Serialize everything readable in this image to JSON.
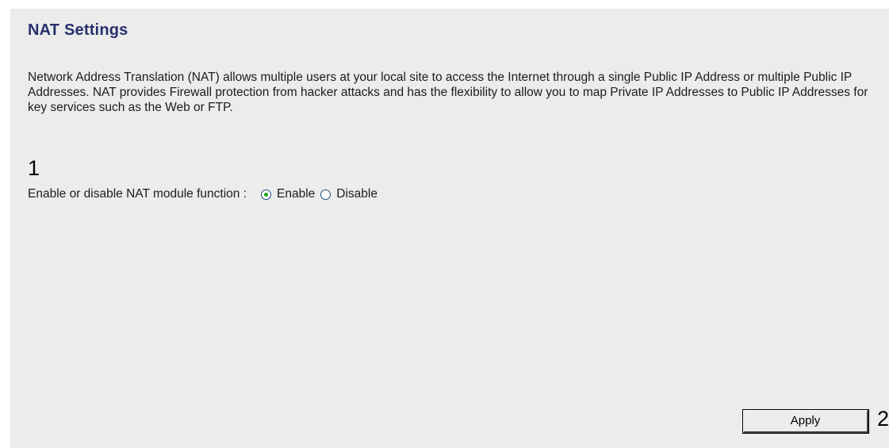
{
  "page": {
    "title": "NAT Settings",
    "description": "Network Address Translation (NAT) allows multiple users at your local site to access the Internet through a single Public IP Address or multiple Public IP Addresses. NAT provides Firewall protection from hacker attacks and has the flexibility to allow you to map Private IP Addresses to Public IP Addresses for key services such as the Web or FTP."
  },
  "callouts": {
    "step1": "1",
    "step2": "2"
  },
  "nat": {
    "label": "Enable or disable NAT module function :",
    "options": [
      {
        "label": "Enable",
        "selected": true
      },
      {
        "label": "Disable",
        "selected": false
      }
    ]
  },
  "actions": {
    "apply_label": "Apply"
  },
  "colors": {
    "panel_background": "#ececec",
    "title": "#28306e",
    "radio_selected": "#21a121"
  }
}
